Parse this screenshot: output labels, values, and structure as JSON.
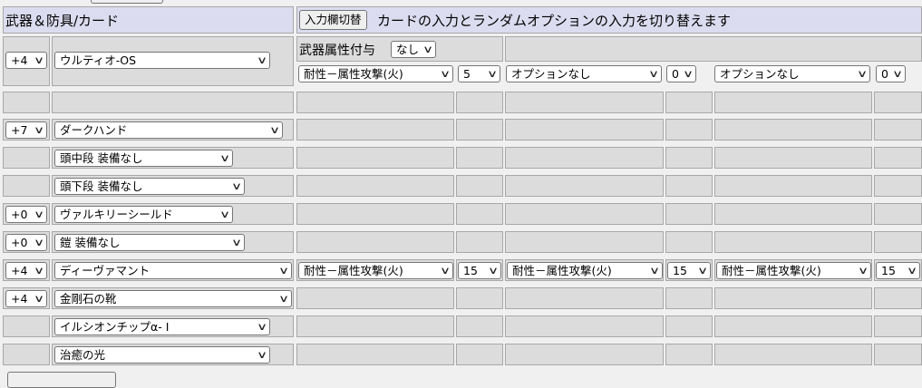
{
  "header": {
    "title": "武器＆防具/カード",
    "toggle_button": "入力欄切替",
    "description": "カードの入力とランダムオプションの入力を切り替えます"
  },
  "weapon": {
    "refine": "+4",
    "name": "ウルティオ-OS",
    "element_label": "武器属性付与",
    "element_value": "なし",
    "options": [
      {
        "name": "耐性－属性攻撃(火)",
        "value": "5"
      },
      {
        "name": "オプションなし",
        "value": "0"
      },
      {
        "name": "オプションなし",
        "value": "0"
      }
    ]
  },
  "equipment": [
    {
      "refine": "+7",
      "name": "ダークハンド"
    },
    {
      "refine": "",
      "name": "頭中段 装備なし"
    },
    {
      "refine": "",
      "name": "頭下段 装備なし"
    },
    {
      "refine": "+0",
      "name": "ヴァルキリーシールド"
    },
    {
      "refine": "+0",
      "name": "鎧 装備なし"
    },
    {
      "refine": "+4",
      "name": "ディーヴァマント",
      "options": [
        {
          "name": "耐性－属性攻撃(火)",
          "value": "15"
        },
        {
          "name": "耐性－属性攻撃(火)",
          "value": "15"
        },
        {
          "name": "耐性－属性攻撃(火)",
          "value": "15"
        }
      ]
    },
    {
      "refine": "+4",
      "name": "金剛石の靴"
    },
    {
      "refine": "",
      "name": "イルシオンチップα- I"
    },
    {
      "refine": "",
      "name": "治癒の光"
    }
  ],
  "icons": {
    "dropdown": "chevron-down-icon"
  },
  "colors": {
    "header_bg": "#dcdcf0",
    "cell_bg": "#dcdcdc",
    "border": "#a8a8a8"
  }
}
